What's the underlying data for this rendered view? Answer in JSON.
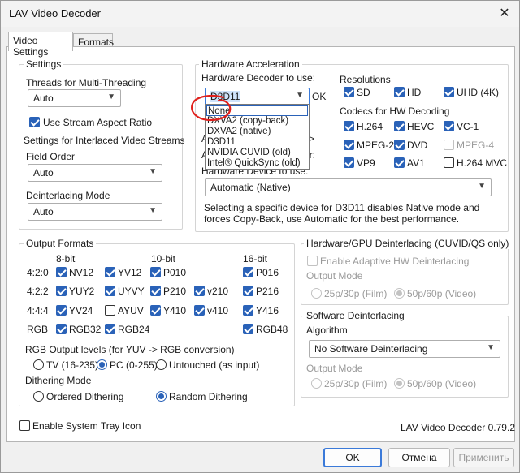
{
  "window": {
    "title": "LAV Video Decoder",
    "close_glyph": "✕"
  },
  "tabs": [
    "Video Settings",
    "Formats"
  ],
  "settings": {
    "group_title": "Settings",
    "threads_label": "Threads for Multi-Threading",
    "threads_value": "Auto",
    "stream_aspect_label": "Use Stream Aspect Ratio",
    "interlaced_label": "Settings for Interlaced Video Streams",
    "field_order_label": "Field Order",
    "field_order_value": "Auto",
    "deinterlacing_label": "Deinterlacing Mode",
    "deinterlacing_value": "Auto"
  },
  "hw_accel": {
    "group_title": "Hardware Acceleration",
    "decoder_label": "Hardware Decoder to use:",
    "decoder_value": "D3D11",
    "status": "OK",
    "dropdown_options": [
      "None",
      "DXVA2 (copy-back)",
      "DXVA2 (native)",
      "D3D11",
      "NVIDIA CUVID (old)",
      "Intel® QuickSync (old)"
    ],
    "hidden_fragments": [
      "A",
      ">",
      "or:",
      "A"
    ],
    "device_label": "Hardware Device to use:",
    "device_value": "Automatic (Native)",
    "note": "Selecting a specific device for D3D11 disables Native mode and forces Copy-Back, use Automatic for the best performance.",
    "resolutions_label": "Resolutions",
    "resolutions": [
      "SD",
      "HD",
      "UHD (4K)"
    ],
    "codecs_label": "Codecs for HW Decoding",
    "codecs": [
      "H.264",
      "HEVC",
      "VC-1",
      "MPEG-2",
      "DVD",
      "MPEG-4",
      "VP9",
      "AV1",
      "H.264 MVC"
    ]
  },
  "output_formats": {
    "group_title": "Output Formats",
    "col_headers": [
      "8-bit",
      "10-bit",
      "16-bit"
    ],
    "row_labels": [
      "4:2:0",
      "4:2:2",
      "4:4:4",
      "RGB"
    ],
    "formats": [
      "NV12",
      "YV12",
      "P010",
      "P016",
      "YUY2",
      "UYVY",
      "P210",
      "v210",
      "P216",
      "YV24",
      "AYUV",
      "Y410",
      "v410",
      "Y416",
      "RGB32",
      "RGB24",
      "RGB48"
    ],
    "rgb_levels_label": "RGB Output levels (for YUV -> RGB conversion)",
    "rgb_levels": [
      "TV (16-235)",
      "PC (0-255)",
      "Untouched (as input)"
    ],
    "dithering_label": "Dithering Mode",
    "dithering": [
      "Ordered Dithering",
      "Random Dithering"
    ]
  },
  "hw_deint": {
    "group_title": "Hardware/GPU Deinterlacing (CUVID/QS only)",
    "enable_label": "Enable Adaptive HW Deinterlacing",
    "output_mode_label": "Output Mode",
    "modes": [
      "25p/30p (Film)",
      "50p/60p (Video)"
    ]
  },
  "sw_deint": {
    "group_title": "Software Deinterlacing",
    "algorithm_label": "Algorithm",
    "algorithm_value": "No Software Deinterlacing",
    "output_mode_label": "Output Mode",
    "modes": [
      "25p/30p (Film)",
      "50p/60p (Video)"
    ]
  },
  "footer": {
    "tray_label": "Enable System Tray Icon",
    "version": "LAV Video Decoder 0.79.2",
    "buttons": [
      "OK",
      "Отмена",
      "Применить"
    ]
  },
  "colors": {
    "accent": "#2a62b8",
    "annotation": "#e0201c"
  }
}
